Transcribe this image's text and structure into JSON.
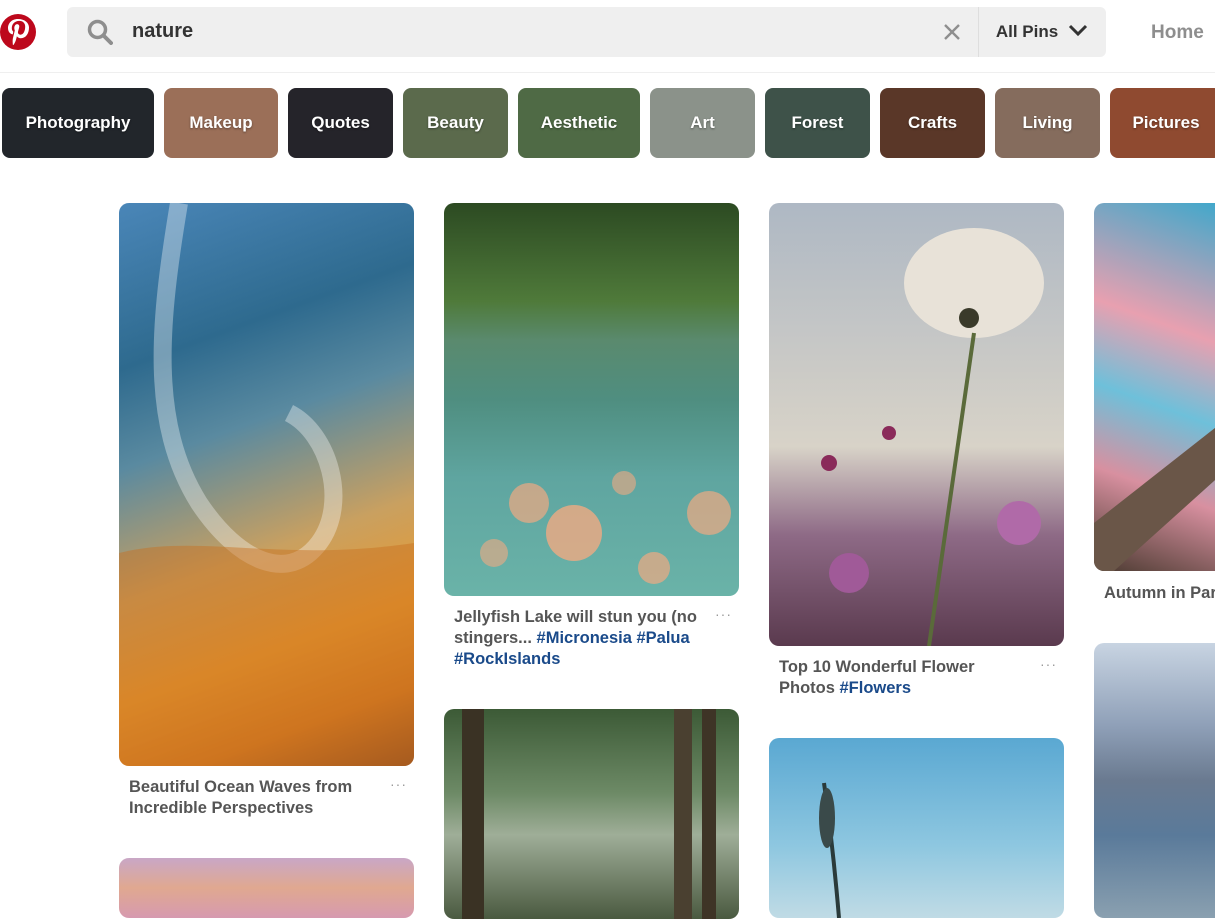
{
  "search": {
    "query": "nature",
    "scope": "All Pins"
  },
  "nav": {
    "home": "Home"
  },
  "chips": [
    {
      "label": "Photography",
      "color": "#22262b"
    },
    {
      "label": "Makeup",
      "color": "#9b6f58"
    },
    {
      "label": "Quotes",
      "color": "#25242a"
    },
    {
      "label": "Beauty",
      "color": "#5b6a4c"
    },
    {
      "label": "Aesthetic",
      "color": "#4f6a45"
    },
    {
      "label": "Art",
      "color": "#8b928a"
    },
    {
      "label": "Forest",
      "color": "#3e5249"
    },
    {
      "label": "Crafts",
      "color": "#5a3728"
    },
    {
      "label": "Living",
      "color": "#856c5d"
    },
    {
      "label": "Pictures",
      "color": "#8f4a30"
    }
  ],
  "pins": {
    "wave": {
      "title": "Beautiful Ocean Waves from Incredible Perspectives",
      "more": "···"
    },
    "jelly": {
      "title": "Jellyfish Lake will stun you (no stingers... ",
      "tags": "#Micronesia #Palua #RockIslands",
      "more": "···"
    },
    "flower": {
      "title": "Top 10 Wonderful Flower Photos ",
      "tags": "#Flowers",
      "more": "···"
    },
    "autumn": {
      "title": "Autumn in Par"
    }
  }
}
